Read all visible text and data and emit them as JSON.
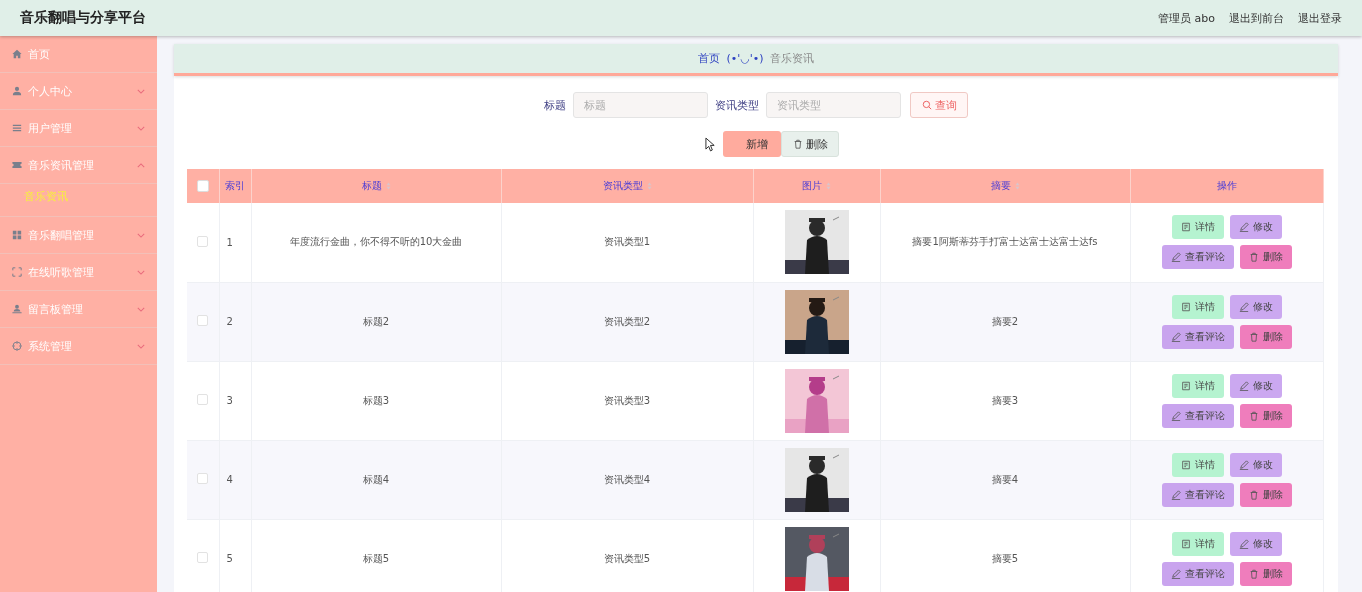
{
  "header": {
    "title": "音乐翻唱与分享平台",
    "links": [
      "管理员 abo",
      "退出到前台",
      "退出登录"
    ]
  },
  "sidebar": {
    "items": [
      {
        "label": "首页",
        "expandable": false
      },
      {
        "label": "个人中心",
        "expandable": true,
        "expanded": false
      },
      {
        "label": "用户管理",
        "expandable": true,
        "expanded": false
      },
      {
        "label": "音乐资讯管理",
        "expandable": true,
        "expanded": true,
        "children": [
          {
            "label": "音乐资讯",
            "selected": true
          }
        ]
      },
      {
        "label": "音乐翻唱管理",
        "expandable": true,
        "expanded": false
      },
      {
        "label": "在线听歌管理",
        "expandable": true,
        "expanded": false
      },
      {
        "label": "留言板管理",
        "expandable": true,
        "expanded": false
      },
      {
        "label": "系统管理",
        "expandable": true,
        "expanded": false
      }
    ]
  },
  "breadcrumb": {
    "home": "首页",
    "separator": "(•'◡'•)",
    "current": "音乐资讯"
  },
  "search": {
    "fields": [
      {
        "label": "标题",
        "placeholder": "标题"
      },
      {
        "label": "资讯类型",
        "placeholder": "资讯类型"
      }
    ],
    "button": "查询"
  },
  "actions": {
    "add": "新增",
    "delete": "删除"
  },
  "table": {
    "all_checked": false,
    "columns": [
      {
        "label": "索引",
        "sortable": false
      },
      {
        "label": "标题",
        "sortable": true
      },
      {
        "label": "资讯类型",
        "sortable": true
      },
      {
        "label": "图片",
        "sortable": true
      },
      {
        "label": "摘要",
        "sortable": true
      },
      {
        "label": "操作",
        "sortable": false
      }
    ],
    "rows": [
      {
        "index": "1",
        "title": "年度流行金曲，你不得不听的10大金曲",
        "type": "资讯类型1",
        "summary": "摘要1阿斯蒂芬手打富士达富士达富士达fs",
        "checked": false,
        "actions": [
          "详情",
          "修改",
          "查看评论",
          "删除"
        ]
      },
      {
        "index": "2",
        "title": "标题2",
        "type": "资讯类型2",
        "summary": "摘要2",
        "checked": false,
        "actions": [
          "详情",
          "修改",
          "查看评论",
          "删除"
        ]
      },
      {
        "index": "3",
        "title": "标题3",
        "type": "资讯类型3",
        "summary": "摘要3",
        "checked": false,
        "actions": [
          "详情",
          "修改",
          "查看评论",
          "删除"
        ]
      },
      {
        "index": "4",
        "title": "标题4",
        "type": "资讯类型4",
        "summary": "摘要4",
        "checked": false,
        "actions": [
          "详情",
          "修改",
          "查看评论",
          "删除"
        ]
      },
      {
        "index": "5",
        "title": "标题5",
        "type": "资讯类型5",
        "summary": "摘要5",
        "checked": false,
        "actions": [
          "详情",
          "修改",
          "查看评论",
          "删除"
        ]
      }
    ]
  }
}
